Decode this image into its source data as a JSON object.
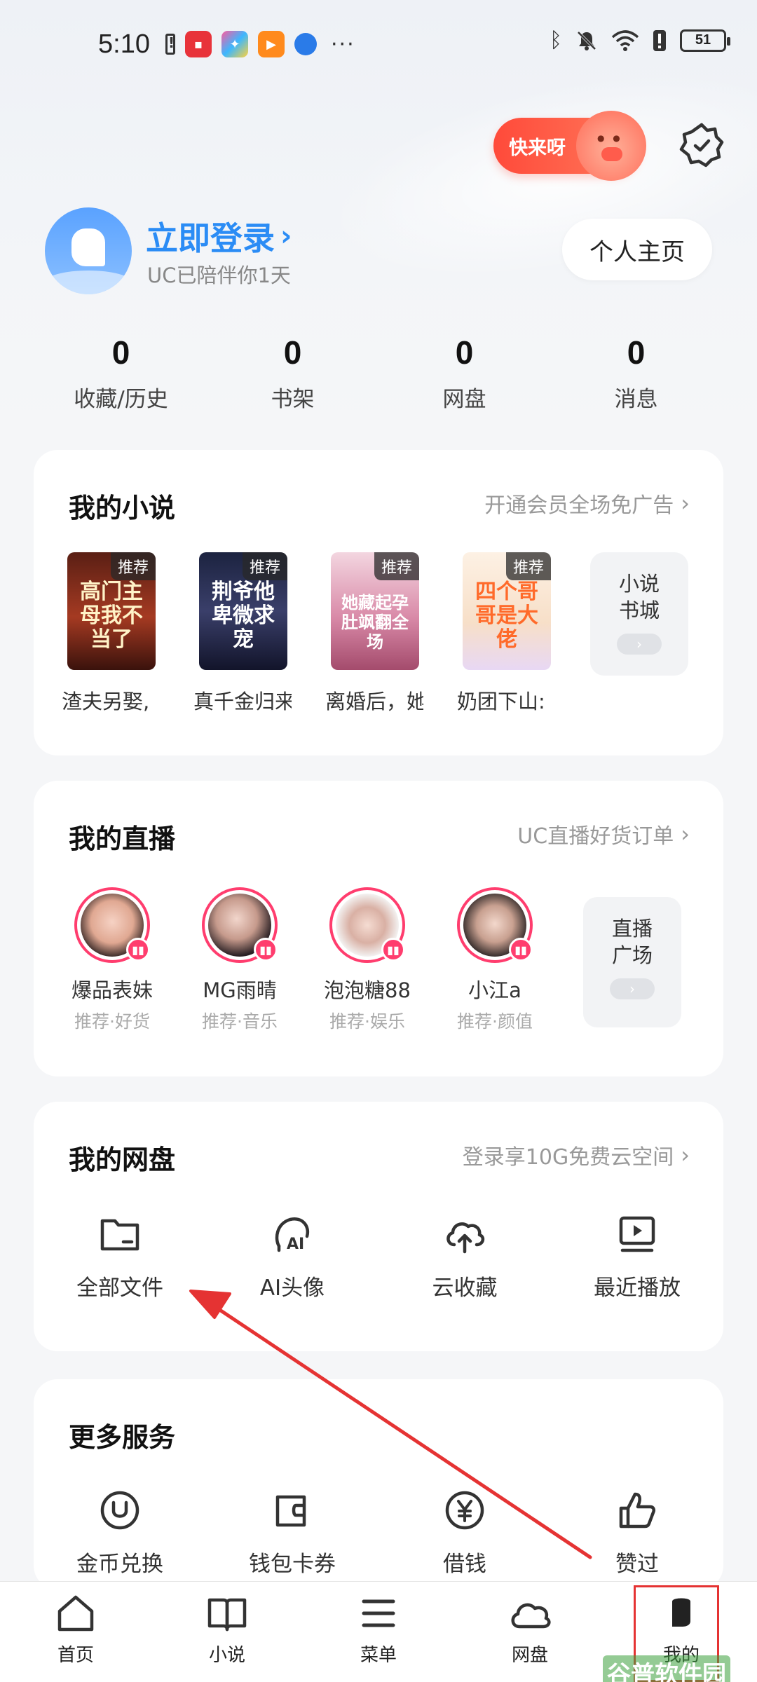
{
  "status_bar": {
    "time": "5:10",
    "battery": "51"
  },
  "header": {
    "promo_label": "快来呀"
  },
  "profile": {
    "login_title": "立即登录",
    "subtitle": "UC已陪伴你1天",
    "home_button": "个人主页"
  },
  "stats": [
    {
      "value": "0",
      "label": "收藏/历史"
    },
    {
      "value": "0",
      "label": "书架"
    },
    {
      "value": "0",
      "label": "网盘"
    },
    {
      "value": "0",
      "label": "消息"
    }
  ],
  "novels": {
    "title": "我的小说",
    "link": "开通会员全场免广告",
    "tag": "推荐",
    "books": [
      {
        "title": "渣夫另娶,",
        "cover_text": "高门主母我不当了"
      },
      {
        "title": "真千金归来",
        "cover_text": "荆爷他卑微求宠"
      },
      {
        "title": "离婚后，她",
        "cover_text": "她藏起孕肚飒翻全场"
      },
      {
        "title": "奶团下山:",
        "cover_text": "四个哥哥是大佬"
      }
    ],
    "more_label_1": "小说",
    "more_label_2": "书城"
  },
  "live": {
    "title": "我的直播",
    "link": "UC直播好货订单",
    "streamers": [
      {
        "name": "爆品表妹",
        "sub": "推荐·好货"
      },
      {
        "name": "MG雨晴",
        "sub": "推荐·音乐"
      },
      {
        "name": "泡泡糖88",
        "sub": "推荐·娱乐"
      },
      {
        "name": "小江a",
        "sub": "推荐·颜值"
      }
    ],
    "more_label_1": "直播",
    "more_label_2": "广场"
  },
  "cloud": {
    "title": "我的网盘",
    "link": "登录享10G免费云空间",
    "items": [
      {
        "label": "全部文件",
        "icon": "folder-icon"
      },
      {
        "label": "AI头像",
        "icon": "ai-avatar-icon"
      },
      {
        "label": "云收藏",
        "icon": "cloud-upload-icon"
      },
      {
        "label": "最近播放",
        "icon": "video-play-icon"
      }
    ]
  },
  "services": {
    "title": "更多服务",
    "items": [
      {
        "label": "金币兑换",
        "icon": "coin-icon"
      },
      {
        "label": "钱包卡券",
        "icon": "wallet-icon"
      },
      {
        "label": "借钱",
        "icon": "yen-icon"
      },
      {
        "label": "赞过",
        "icon": "thumbs-up-icon"
      }
    ]
  },
  "nav": [
    {
      "label": "首页",
      "icon": "home-icon"
    },
    {
      "label": "小说",
      "icon": "book-icon"
    },
    {
      "label": "菜单",
      "icon": "menu-icon"
    },
    {
      "label": "网盘",
      "icon": "cloud-icon"
    },
    {
      "label": "我的",
      "icon": "profile-icon"
    }
  ],
  "watermark": "谷普软件园",
  "colors": {
    "accent": "#2b8cf5",
    "live_ring": "#ff3d6e",
    "annotation": "#e53333"
  }
}
